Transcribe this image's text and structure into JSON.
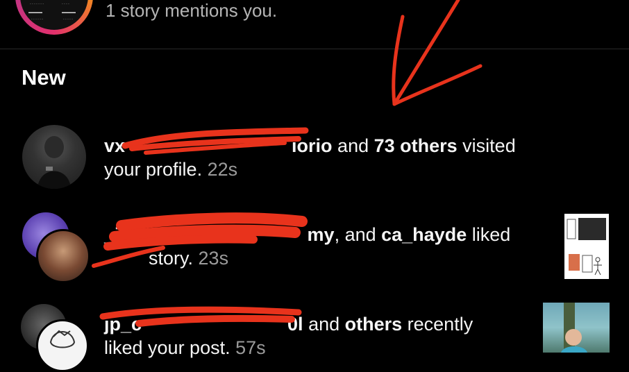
{
  "header": {
    "story_mentions_text": "1 story mentions you."
  },
  "section": {
    "title": "New"
  },
  "notifications": [
    {
      "visible_user_fragment": "vx",
      "visible_user_fragment_end": "iorio",
      "connector": " and ",
      "others": "73 others",
      "action": " visited",
      "line2": "your profile.",
      "time": "22s"
    },
    {
      "visible_user_fragment": "_i",
      "visible_user_fragment_end": "my",
      "connector": ", and ",
      "user2": "ca_hayde",
      "action": " liked",
      "line2_part": "story.",
      "time": "23s"
    },
    {
      "visible_user_fragment": "jp_c",
      "visible_user_fragment_end": "0l",
      "connector": " and ",
      "others": "others",
      "action": " recently",
      "line2": "liked your post.",
      "time": "57s"
    }
  ],
  "annotation": {
    "color": "#e8331c"
  }
}
